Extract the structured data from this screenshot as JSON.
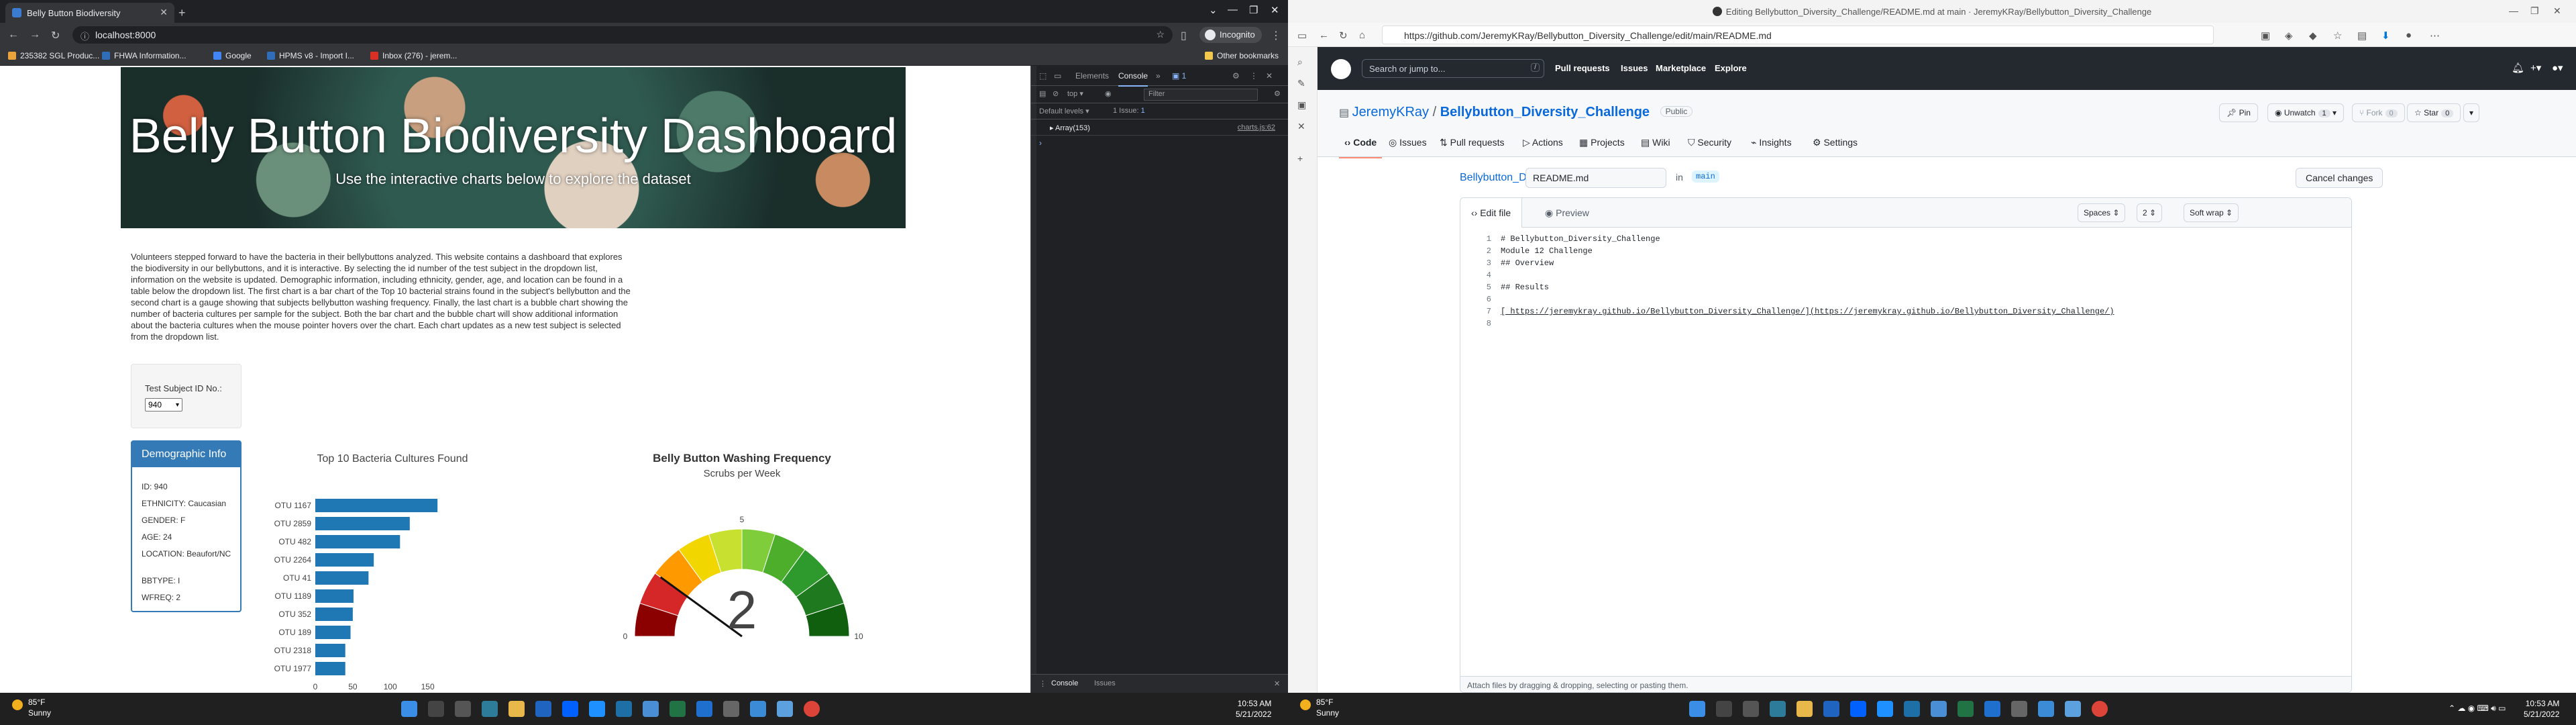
{
  "left_browser": {
    "tab_title": "Belly Button Biodiversity",
    "url": "localhost:8000",
    "incognito_label": "Incognito",
    "bookmarks": [
      {
        "label": "235382 SGL Produc...",
        "color": "#e8a33a"
      },
      {
        "label": "FHWA Information...",
        "color": "#2f6db8"
      },
      {
        "label": "Google",
        "color": "#4285f4"
      },
      {
        "label": "HPMS v8 - Import I...",
        "color": "#2f6db8"
      },
      {
        "label": "Inbox (276) - jerem...",
        "color": "#d93025"
      }
    ],
    "other_bookmarks": "Other bookmarks"
  },
  "dashboard": {
    "title": "Belly Button Biodiversity Dashboard",
    "subtitle": "Use the interactive charts below to explore the dataset",
    "intro": "Volunteers stepped forward to have the bacteria in their bellybuttons analyzed. This website contains a dashboard that explores the biodiversity in our bellybuttons, and it is interactive. By selecting the id number of the test subject in the dropdown list, information on the website is updated. Demographic information, including ethnicity, gender, age, and location can be found in a table below the dropdown list. The first chart is a bar chart of the Top 10 bacterial strains found in the subject's bellybutton and the second chart is a gauge showing that subjects bellybutton washing frequency. Finally, the last chart is a bubble chart showing the number of bacteria cultures per sample for the subject. Both the bar chart and the bubble chart will show additional information about the bacteria cultures when the mouse pointer hovers over the chart. Each chart updates as a new test subject is selected from the dropdown list.",
    "select_label": "Test Subject ID No.:",
    "selected_id": "940",
    "demo_title": "Demographic Info",
    "demo_lines": [
      "ID: 940",
      "ETHNICITY: Caucasian",
      "GENDER: F",
      "AGE: 24",
      "LOCATION: Beaufort/NC",
      "BBTYPE: I",
      "WFREQ: 2"
    ]
  },
  "chart_data": [
    {
      "type": "bar",
      "orientation": "horizontal",
      "title": "Top 10 Bacteria Cultures Found",
      "categories": [
        "OTU 1167",
        "OTU 2859",
        "OTU 482",
        "OTU 2264",
        "OTU 41",
        "OTU 1189",
        "OTU 352",
        "OTU 189",
        "OTU 2318",
        "OTU 1977"
      ],
      "values": [
        163,
        126,
        113,
        78,
        71,
        51,
        50,
        47,
        40,
        40
      ],
      "xticks": [
        "0",
        "50",
        "100",
        "150"
      ],
      "xlim": [
        0,
        170
      ],
      "color": "#1f77b4"
    },
    {
      "type": "gauge",
      "title": "Belly Button Washing Frequency",
      "subtitle": "Scrubs per Week",
      "value": 2,
      "value_label": "2",
      "range": [
        0,
        10
      ],
      "tick_labels": [
        "0",
        "5",
        "10"
      ],
      "bands": [
        "#8b0000",
        "#d62728",
        "#ff9900",
        "#f2d600",
        "#c8e030",
        "#7fcd3a",
        "#4cae2a",
        "#2e9a2e",
        "#1f7a1f",
        "#0f5f0f"
      ]
    }
  ],
  "devtools": {
    "tabs": [
      "Elements",
      "Console"
    ],
    "context": "top",
    "levels": "Default levels",
    "issues": "1 Issue:",
    "issues_count": "1",
    "filter_placeholder": "Filter",
    "log_text": "Array(153)",
    "log_source": "charts.js:62",
    "drawer_tabs": [
      "Console",
      "Issues"
    ]
  },
  "taskbar": {
    "temp": "85°F",
    "weather": "Sunny",
    "time": "10:53 AM",
    "date": "5/21/2022"
  },
  "right_browser": {
    "window_title": "Editing Bellybutton_Diversity_Challenge/README.md at main · JeremyKRay/Bellybutton_Diversity_Challenge",
    "url": "https://github.com/JeremyKRay/Bellybutton_Diversity_Challenge/edit/main/README.md"
  },
  "github": {
    "search_placeholder": "Search or jump to...",
    "search_key": "/",
    "nav": [
      "Pull requests",
      "Issues",
      "Marketplace",
      "Explore"
    ],
    "owner": "JeremyKRay",
    "repo": "Bellybutton_Diversity_Challenge",
    "visibility": "Public",
    "pin": "Pin",
    "unwatch": "Unwatch",
    "unwatch_count": "1",
    "fork": "Fork",
    "fork_count": "0",
    "star": "Star",
    "star_count": "0",
    "tabs": [
      "Code",
      "Issues",
      "Pull requests",
      "Actions",
      "Projects",
      "Wiki",
      "Security",
      "Insights",
      "Settings"
    ],
    "crumb": "Bellybutton_Diversity_Challenge",
    "crumb_sep": "/",
    "file_name": "README.md",
    "in_label": "in",
    "branch": "main",
    "cancel": "Cancel changes",
    "edit_tab": "Edit file",
    "preview_tab": "Preview",
    "indent_mode": "Spaces",
    "indent_size": "2",
    "wrap_mode": "Soft wrap",
    "code_lines": [
      {
        "n": "1",
        "text": "# Bellybutton_Diversity_Challenge"
      },
      {
        "n": "2",
        "text": "Module 12 Challenge"
      },
      {
        "n": "3",
        "text": "## Overview"
      },
      {
        "n": "4",
        "text": ""
      },
      {
        "n": "5",
        "text": "## Results"
      },
      {
        "n": "6",
        "text": ""
      },
      {
        "n": "7",
        "text": "[ https://jeremykray.github.io/Bellybutton_Diversity_Challenge/](https://jeremykray.github.io/Bellybutton_Diversity_Challenge/)"
      },
      {
        "n": "8",
        "text": ""
      }
    ],
    "footer_text": "Attach files by dragging & dropping, selecting or pasting them."
  }
}
